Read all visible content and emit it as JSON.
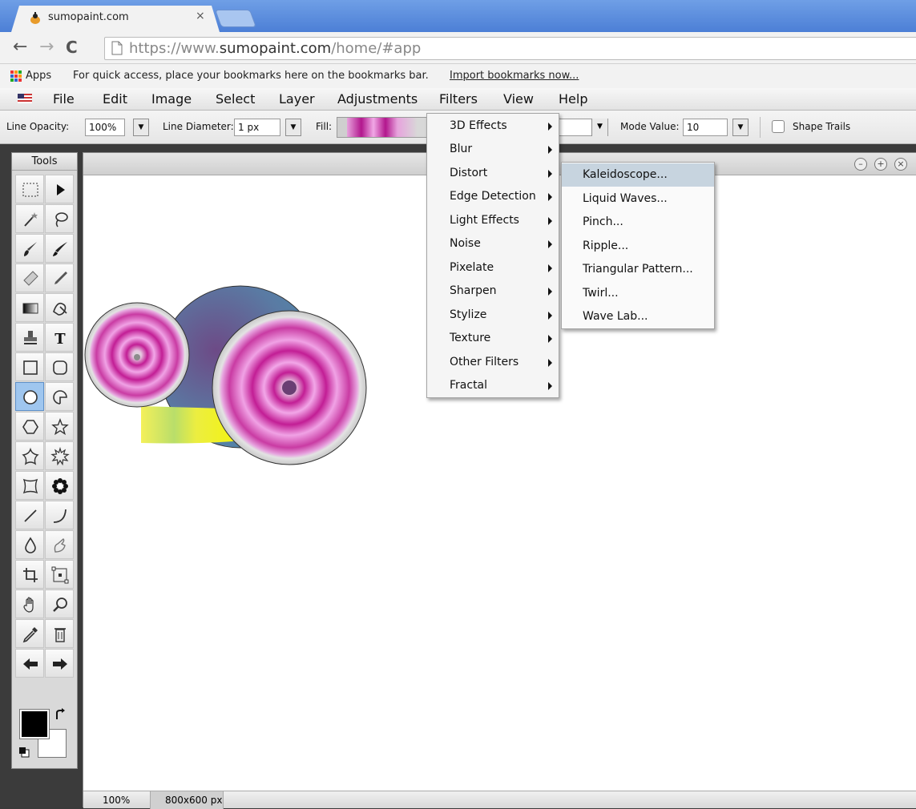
{
  "browser": {
    "tab_title": "sumopaint.com",
    "tab_close": "×",
    "url_prefix": "https://www.",
    "url_host": "sumopaint.com",
    "url_path": "/home/#app",
    "apps_label": "Apps",
    "bookmarks_hint": "For quick access, place your bookmarks here on the bookmarks bar.",
    "import_link": "Import bookmarks now..."
  },
  "menubar": {
    "items": [
      "File",
      "Edit",
      "Image",
      "Select",
      "Layer",
      "Adjustments",
      "Filters",
      "View",
      "Help"
    ]
  },
  "options": {
    "line_opacity_label": "Line Opacity:",
    "line_opacity_value": "100%",
    "line_diameter_label": "Line Diameter:",
    "line_diameter_value": "1 px",
    "fill_label": "Fill:",
    "mode_value_label": "Mode Value:",
    "mode_value": "10",
    "shape_trails_label": "Shape Trails",
    "shape_trails_checked": false
  },
  "tools": {
    "title": "Tools",
    "active": "ellipse-tool"
  },
  "colors": {
    "foreground": "#000000",
    "background": "#ffffff"
  },
  "filters_menu": {
    "items": [
      {
        "label": "3D Effects",
        "submenu": true
      },
      {
        "label": "Blur",
        "submenu": true
      },
      {
        "label": "Distort",
        "submenu": true
      },
      {
        "label": "Edge Detection",
        "submenu": true
      },
      {
        "label": "Light Effects",
        "submenu": true
      },
      {
        "label": "Noise",
        "submenu": true
      },
      {
        "label": "Pixelate",
        "submenu": true
      },
      {
        "label": "Sharpen",
        "submenu": true
      },
      {
        "label": "Stylize",
        "submenu": true
      },
      {
        "label": "Texture",
        "submenu": true
      },
      {
        "label": "Other Filters",
        "submenu": true
      },
      {
        "label": "Fractal",
        "submenu": true
      }
    ]
  },
  "distort_submenu": {
    "items": [
      "Kaleidoscope...",
      "Liquid Waves...",
      "Pinch...",
      "Ripple...",
      "Triangular Pattern...",
      "Twirl...",
      "Wave Lab..."
    ],
    "highlighted": "Kaleidoscope..."
  },
  "status": {
    "zoom": "100%",
    "canvas_size": "800x600 px"
  }
}
